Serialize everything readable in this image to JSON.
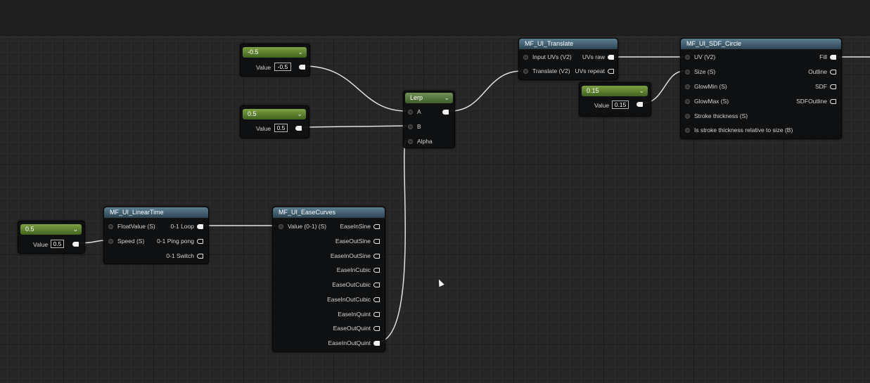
{
  "constants": {
    "c1": {
      "title": "-0.5",
      "value_label": "Value",
      "value": "-0.5"
    },
    "c2": {
      "title": "0.5",
      "value_label": "Value",
      "value": "0.5"
    },
    "c3": {
      "title": "0.15",
      "value_label": "Value",
      "value": "0.15"
    },
    "c4": {
      "title": "0.5",
      "value_label": "Value",
      "value": "0.5"
    }
  },
  "lerp": {
    "title": "Lerp",
    "inputs": [
      "A",
      "B",
      "Alpha"
    ]
  },
  "translate": {
    "title": "MF_UI_Translate",
    "inputs": [
      "Input UVs (V2)",
      "Translate (V2)"
    ],
    "outputs": [
      "UVs raw",
      "UVs repeat"
    ]
  },
  "circle": {
    "title": "MF_UI_SDF_Circle",
    "inputs": [
      "UV (V2)",
      "Size (S)",
      "GlowMin (S)",
      "GlowMax (S)",
      "Stroke thickness (S)",
      "Is stroke thickness relative to size (B)"
    ],
    "outputs": [
      "Fill",
      "Outline",
      "SDF",
      "SDFOutline"
    ]
  },
  "linear_time": {
    "title": "MF_UI_LinearTime",
    "inputs": [
      "FloatValue (S)",
      "Speed (S)"
    ],
    "outputs": [
      "0-1 Loop",
      "0-1 Ping pong",
      "0-1 Switch"
    ]
  },
  "ease_curves": {
    "title": "MF_UI_EaseCurves",
    "inputs": [
      "Value (0-1) (S)"
    ],
    "outputs": [
      "EaseInSine",
      "EaseOutSine",
      "EaseInOutSine",
      "EaseInCubic",
      "EaseOutCubic",
      "EaseInOutCubic",
      "EaseInQuint",
      "EaseOutQuint",
      "EaseInOutQuint"
    ]
  },
  "icons": {
    "dropdown": "chevron-down-icon",
    "pin": "exec-pin-icon"
  }
}
